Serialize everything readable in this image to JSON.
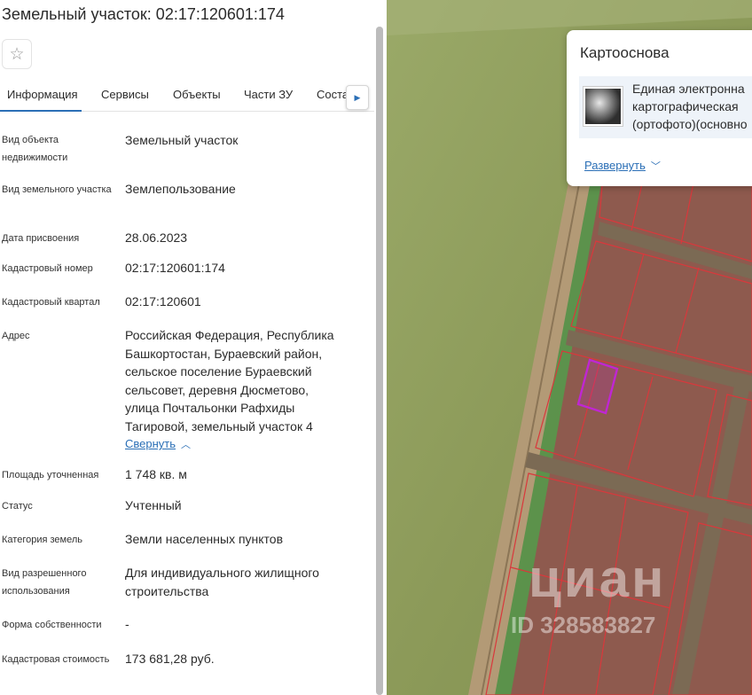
{
  "header": {
    "title": "Земельный участок: 02:17:120601:174"
  },
  "tabs": [
    {
      "label": "Информация",
      "active": true
    },
    {
      "label": "Сервисы"
    },
    {
      "label": "Объекты"
    },
    {
      "label": "Части ЗУ"
    },
    {
      "label": "Соста"
    }
  ],
  "fields": {
    "object_type": {
      "label": "Вид объекта недвижимости",
      "value": "Земельный участок"
    },
    "land_type": {
      "label": "Вид земельного участка",
      "value": "Землепользование"
    },
    "assign_date": {
      "label": "Дата присвоения",
      "value": "28.06.2023"
    },
    "cad_number": {
      "label": "Кадастровый номер",
      "value": "02:17:120601:174"
    },
    "cad_quarter": {
      "label": "Кадастровый квартал",
      "value": "02:17:120601"
    },
    "address": {
      "label": "Адрес",
      "lines": [
        "Российская Федерация, Республика",
        "Башкортостан, Бураевский район,",
        "сельское поселение Бураевский",
        "сельсовет, деревня Дюсметово,",
        "улица Почтальонки Рафхиды",
        "Тагировой, земельный участок 4"
      ],
      "collapse_label": "Свернуть"
    },
    "area": {
      "label": "Площадь уточненная",
      "value": "1 748 кв. м"
    },
    "status": {
      "label": "Статус",
      "value": "Учтенный"
    },
    "land_category": {
      "label": "Категория земель",
      "value": "Земли населенных пунктов"
    },
    "permitted_use": {
      "label": "Вид разрешенного использования",
      "lines": [
        "Для индивидуального жилищного",
        "строительства"
      ]
    },
    "ownership": {
      "label": "Форма собственности",
      "value": "-"
    },
    "cad_value": {
      "label": "Кадастровая стоимость",
      "value": "173 681,28 руб."
    }
  },
  "map": {
    "watermark": "циан",
    "watermark_id": "ID 328583827",
    "basemap_card": {
      "title": "Картооснова",
      "item_lines": [
        "Единая электронна",
        "картографическая",
        "(ортофото)(основно"
      ],
      "expand_label": "Развернуть"
    },
    "colors": {
      "field": "#8c9a59",
      "plot_fill": "#8e5a4e",
      "plot_border": "#d9383c",
      "selected": "#c026d3",
      "link": "#2b6fb6"
    }
  },
  "icons": {
    "favorite": "star-icon",
    "next_tab": "chevron-right-icon",
    "collapse": "chevron-up-icon",
    "expand": "chevron-down-icon"
  }
}
